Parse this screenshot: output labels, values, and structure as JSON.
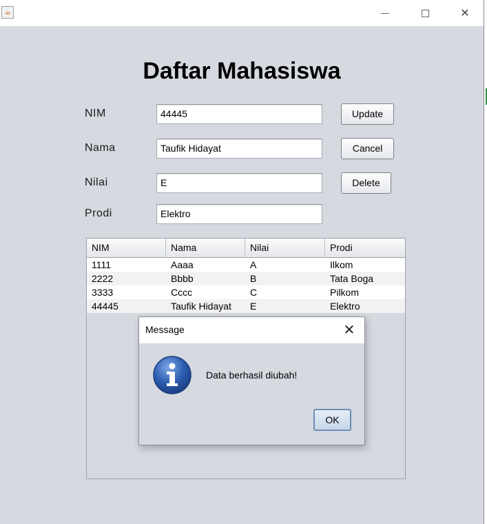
{
  "window": {
    "title": "",
    "controls": {
      "minimize_icon": "minimize-icon",
      "maximize_icon": "maximize-icon",
      "close_glyph": "✕"
    }
  },
  "form": {
    "heading": "Daftar Mahasiswa",
    "labels": {
      "nim": "NIM",
      "nama": "Nama",
      "nilai": "Nilai",
      "prodi": "Prodi"
    },
    "values": {
      "nim": "44445",
      "nama": "Taufik Hidayat",
      "nilai": "E",
      "prodi": "Elektro"
    },
    "buttons": {
      "update": "Update",
      "cancel": "Cancel",
      "delete": "Delete"
    }
  },
  "table": {
    "columns": [
      "NIM",
      "Nama",
      "Nilai",
      "Prodi"
    ],
    "rows": [
      [
        "1111",
        "Aaaa",
        "A",
        "Ilkom"
      ],
      [
        "2222",
        "Bbbb",
        "B",
        "Tata Boga"
      ],
      [
        "3333",
        "Cccc",
        "C",
        "Pilkom"
      ],
      [
        "44445",
        "Taufik Hidayat",
        "E",
        "Elektro"
      ]
    ]
  },
  "dialog": {
    "title": "Message",
    "close_glyph": "✕",
    "message": "Data berhasil diubah!",
    "ok_label": "OK",
    "icon": "info-icon"
  },
  "colors": {
    "window_bg": "#d6d9df",
    "info_blue": "#2a5db0",
    "ok_border": "#6b8fb5"
  }
}
